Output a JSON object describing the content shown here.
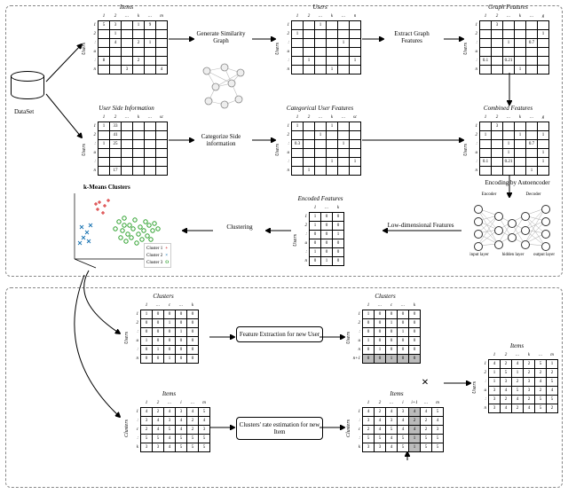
{
  "domain": "Diagram",
  "dataset_label": "DataSet",
  "top_frame": {
    "items_matrix": {
      "title": "Items",
      "row_axis": "Users",
      "cols": [
        "1",
        "2",
        "…",
        "k",
        "…",
        "m"
      ],
      "rows": [
        "1",
        "2",
        ":",
        "u",
        ":",
        "n"
      ],
      "cells": [
        [
          "5",
          "3",
          "",
          "1",
          "9",
          ""
        ],
        [
          "",
          "1",
          "",
          "",
          "",
          ""
        ],
        [
          "",
          "4",
          "",
          "2",
          "1",
          ""
        ],
        [
          "",
          "",
          "",
          "",
          "",
          ""
        ],
        [
          "8",
          "",
          "",
          "2",
          "",
          ""
        ],
        [
          "",
          "",
          "3",
          "",
          "",
          "4"
        ]
      ]
    },
    "users_matrix": {
      "title": "Users",
      "row_axis": "Users",
      "cols": [
        "1",
        "2",
        "…",
        "k",
        "…",
        "n"
      ],
      "rows": [
        "1",
        "2",
        ":",
        "u",
        ":",
        "n"
      ],
      "cells": [
        [
          "",
          "",
          "1",
          "",
          "",
          ""
        ],
        [
          "1",
          "",
          "",
          "",
          "",
          ""
        ],
        [
          "",
          "",
          "",
          "",
          "1",
          ""
        ],
        [
          "",
          "",
          "",
          "",
          "",
          ""
        ],
        [
          "",
          "1",
          "",
          "",
          "",
          "1"
        ],
        [
          "",
          "",
          "",
          "1",
          "",
          ""
        ]
      ]
    },
    "graph_features_matrix": {
      "title": "Graph Features",
      "row_axis": "Users",
      "cols": [
        "1",
        "2",
        "…",
        "k",
        "…",
        "g"
      ],
      "rows": [
        "1",
        "2",
        ":",
        "u",
        ":",
        "n"
      ],
      "cells": [
        [
          "",
          "3",
          "",
          "",
          "",
          ""
        ],
        [
          "",
          "",
          "",
          "",
          "",
          "1"
        ],
        [
          "",
          "",
          "1",
          "",
          "0.7",
          ""
        ],
        [
          "",
          "",
          "",
          "",
          "",
          ""
        ],
        [
          "0.1",
          "",
          "0.21",
          "",
          "",
          ""
        ],
        [
          "",
          "",
          "",
          "1",
          "",
          ""
        ]
      ]
    },
    "user_side_info": {
      "title": "User Side Information",
      "row_axis": "Users",
      "cols": [
        "1",
        "2",
        "…",
        "k",
        "…",
        "sc"
      ],
      "rows": [
        "1",
        "2",
        ":",
        "u",
        ":",
        "n"
      ],
      "cells": [
        [
          "1",
          "33",
          "",
          "",
          "",
          ""
        ],
        [
          "",
          "41",
          "",
          "",
          "",
          ""
        ],
        [
          "1",
          "25",
          "",
          "",
          "",
          ""
        ],
        [
          "",
          "",
          "",
          "",
          "",
          ""
        ],
        [
          "",
          "",
          "",
          "",
          "",
          ""
        ],
        [
          "",
          "17",
          "",
          "",
          "",
          ""
        ]
      ]
    },
    "categorical_user_features": {
      "title": "Categorical User Features",
      "row_axis": "Users",
      "cols": [
        "1",
        "2",
        "…",
        "k",
        "…",
        "sc"
      ],
      "rows": [
        "1",
        "2",
        ":",
        "u",
        ":",
        "n"
      ],
      "cells": [
        [
          "1",
          "",
          "",
          "1",
          "",
          ""
        ],
        [
          "",
          "",
          "1",
          "",
          "",
          ""
        ],
        [
          "0.3",
          "",
          "",
          "",
          "1",
          ""
        ],
        [
          "",
          "",
          "",
          "",
          "",
          ""
        ],
        [
          "",
          "",
          "",
          "1",
          "",
          "1"
        ],
        [
          "",
          "1",
          "",
          "",
          "",
          ""
        ]
      ]
    },
    "combined_features": {
      "title": "Combined Features",
      "row_axis": "Users",
      "cols": [
        "1",
        "2",
        "…",
        "k",
        "…",
        "g"
      ],
      "rows": [
        "1",
        "2",
        ":",
        "u",
        ":",
        "n"
      ],
      "cells": [
        [
          "",
          "3",
          "",
          "",
          "",
          ""
        ],
        [
          "1",
          "",
          "",
          "1",
          "",
          "1"
        ],
        [
          "",
          "",
          "1",
          "",
          "0.7",
          ""
        ],
        [
          "",
          "",
          "1",
          "",
          "",
          "1"
        ],
        [
          "0.1",
          "",
          "0.21",
          "",
          "",
          "1"
        ],
        [
          "",
          "",
          "",
          "",
          "1",
          ""
        ]
      ]
    },
    "encoded_features": {
      "title": "Encoded Features",
      "row_axis": "Users",
      "cols": [
        "1",
        "…",
        "k"
      ],
      "rows": [
        "1",
        "2",
        ":",
        "u",
        ":",
        "n"
      ],
      "cells": [
        [
          "1",
          "0",
          "0"
        ],
        [
          "1",
          "0",
          "0"
        ],
        [
          "0",
          "0",
          "1"
        ],
        [
          "0",
          "0",
          "0"
        ],
        [
          "1",
          "0",
          "0"
        ],
        [
          "0",
          "1",
          "0"
        ]
      ]
    },
    "step_labels": {
      "gen_graph": "Generate Similarity Graph",
      "extract_graph": "Extract Graph Features",
      "categorize": "Categorize Side information",
      "encoding": "Encoding by Autoencoder",
      "lowdim": "Low-dimensional Features",
      "clustering": "Clustering"
    },
    "autoencoder": {
      "encoder_label": "Encoder",
      "decoder_label": "Decoder",
      "input_label": "input layer",
      "hidden_label": "hidden layer",
      "output_label": "output layer"
    },
    "scatter": {
      "title": "k-Means Clusters",
      "legend": [
        {
          "label": "Cluster 1",
          "marker": "+",
          "color": "#d62728"
        },
        {
          "label": "Cluster 2",
          "marker": "x",
          "color": "#1f77b4"
        },
        {
          "label": "Cluster 3",
          "marker": "O",
          "color": "#2ca02c"
        }
      ]
    }
  },
  "bottom_frame": {
    "clusters_users": {
      "title": "Clusters",
      "row_axis": "Users",
      "cols": [
        "1",
        "…",
        "c",
        "…",
        "k"
      ],
      "rows": [
        "1",
        "2",
        ":",
        "u",
        ":",
        "n"
      ],
      "cells": [
        [
          "1",
          "0",
          "0",
          "0",
          "0"
        ],
        [
          "0",
          "0",
          "1",
          "0",
          "0"
        ],
        [
          "0",
          "0",
          "0",
          "1",
          "0"
        ],
        [
          "1",
          "0",
          "0",
          "0",
          "0"
        ],
        [
          "0",
          "1",
          "0",
          "0",
          "0"
        ],
        [
          "0",
          "0",
          "1",
          "0",
          "0"
        ]
      ]
    },
    "clusters_users_ext": {
      "title": "Clusters",
      "row_axis": "Users",
      "cols": [
        "1",
        "…",
        "c",
        "…",
        "k"
      ],
      "rows": [
        "1",
        "2",
        ":",
        "u",
        "n",
        "n+1"
      ],
      "cells": [
        [
          "1",
          "0",
          "0",
          "0",
          "0"
        ],
        [
          "0",
          "0",
          "1",
          "0",
          "0"
        ],
        [
          "0",
          "0",
          "0",
          "1",
          "0"
        ],
        [
          "1",
          "0",
          "0",
          "0",
          "0"
        ],
        [
          "0",
          "1",
          "0",
          "0",
          "0"
        ],
        [
          "0",
          "0",
          "1",
          "0",
          "0"
        ]
      ],
      "shaded_row_index": 5
    },
    "items_clusters": {
      "title": "Items",
      "row_axis": "Clusters",
      "cols": [
        "1",
        "2",
        "…",
        "i",
        "…",
        "m"
      ],
      "rows": [
        "1",
        ":",
        "c",
        ":",
        "k"
      ],
      "cells": [
        [
          "4",
          "2",
          "4",
          "3",
          "4",
          "5"
        ],
        [
          "3",
          "4",
          "3",
          "4",
          "2",
          "4"
        ],
        [
          "2",
          "4",
          "5",
          "4",
          "2",
          "3"
        ],
        [
          "5",
          "5",
          "4",
          "5",
          "5",
          "5"
        ],
        [
          "3",
          "3",
          "4",
          "5",
          "5",
          "5"
        ]
      ]
    },
    "items_clusters_ext": {
      "title": "Items",
      "row_axis": "Clusters",
      "cols": [
        "1",
        "2",
        "…",
        "i",
        "i+1",
        "…",
        "m"
      ],
      "rows": [
        "1",
        ":",
        "c",
        ":",
        "k"
      ],
      "cells": [
        [
          "4",
          "2",
          "4",
          "3",
          "4",
          "4",
          "5"
        ],
        [
          "3",
          "4",
          "3",
          "4",
          "2",
          "2",
          "4"
        ],
        [
          "2",
          "4",
          "5",
          "4",
          "4",
          "2",
          "3"
        ],
        [
          "5",
          "5",
          "4",
          "5",
          "1",
          "5",
          "5"
        ],
        [
          "3",
          "3",
          "4",
          "5",
          "1",
          "5",
          "5"
        ]
      ],
      "shaded_col_index": 4
    },
    "result_items": {
      "title": "Items",
      "row_axis": "Users",
      "cols": [
        "1",
        "2",
        "…",
        "k",
        "…",
        "m"
      ],
      "rows": [
        "1",
        "2",
        ":",
        "u",
        ":",
        "n"
      ],
      "cells": [
        [
          "4",
          "2",
          "4",
          "2",
          "5",
          "1"
        ],
        [
          "1",
          "5",
          "1",
          "2",
          "2",
          "2"
        ],
        [
          "1",
          "3",
          "2",
          "3",
          "4",
          "5"
        ],
        [
          "3",
          "4",
          "5",
          "3",
          "2",
          "4"
        ],
        [
          "3",
          "2",
          "4",
          "2",
          "5",
          "5"
        ],
        [
          "3",
          "4",
          "2",
          "4",
          "5",
          "2"
        ]
      ]
    },
    "step_labels": {
      "feature_new_user": "Feature Extraction for new User",
      "cluster_rate_new_item": "Clusters' rate estimation for new Item"
    },
    "multiply_symbol": "×"
  }
}
